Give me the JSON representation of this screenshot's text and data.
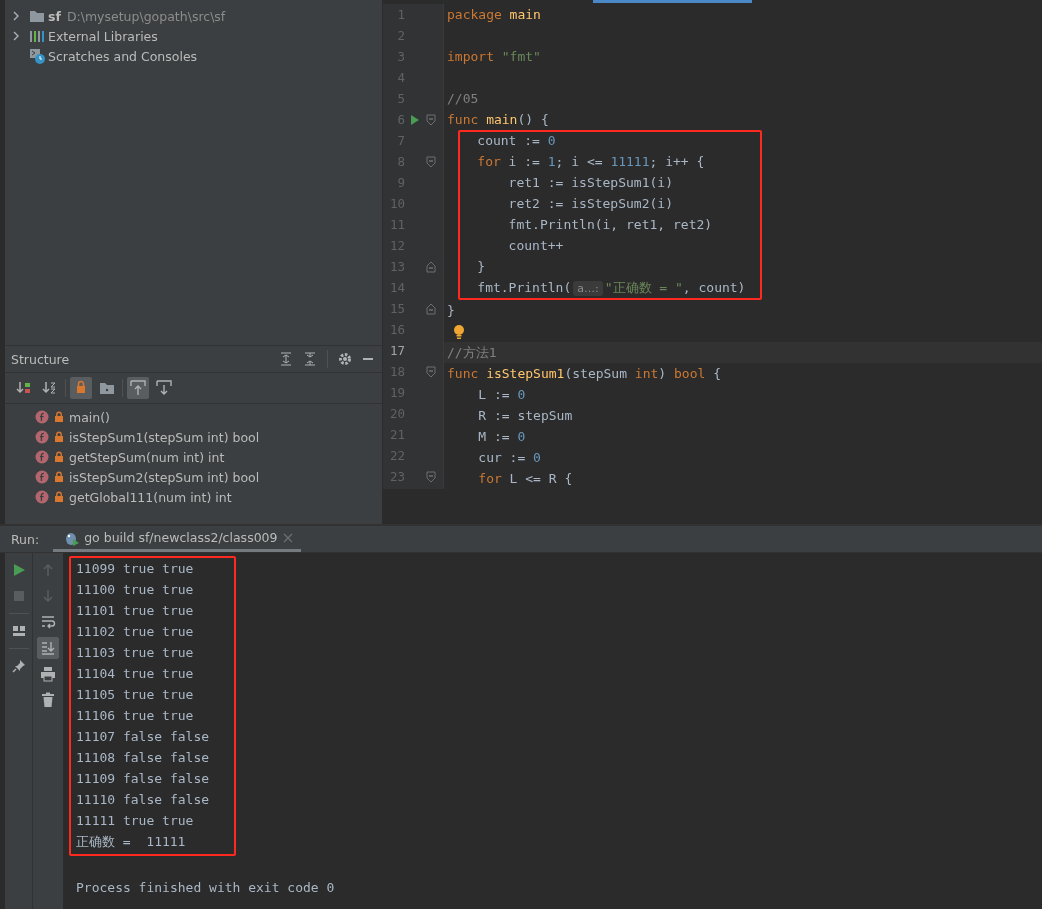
{
  "project_tree": {
    "items": [
      {
        "kind": "folder",
        "name": "sf",
        "path": "D:\\mysetup\\gopath\\src\\sf",
        "expandable": true
      },
      {
        "kind": "libraries",
        "name": "External Libraries",
        "expandable": true
      },
      {
        "kind": "scratches",
        "name": "Scratches and Consoles",
        "expandable": false
      }
    ]
  },
  "structure": {
    "title": "Structure",
    "toolbar": [
      {
        "kind": "sort-visibility",
        "selected": false
      },
      {
        "kind": "sort-alpha",
        "selected": false
      },
      {
        "kind": "lock",
        "selected": true
      },
      {
        "kind": "folder",
        "selected": false
      },
      {
        "kind": "scroll-to",
        "selected": true
      },
      {
        "kind": "scroll-from",
        "selected": false
      }
    ],
    "items": [
      {
        "label": "main()"
      },
      {
        "label": "isStepSum1(stepSum int) bool"
      },
      {
        "label": "getStepSum(num int) int"
      },
      {
        "label": "isStepSum2(stepSum int) bool"
      },
      {
        "label": "getGlobal111(num int) int"
      }
    ]
  },
  "editor": {
    "lines": [
      {
        "number": "1",
        "tokens": [
          {
            "kind": "keyword",
            "text": "package"
          },
          {
            "kind": "function",
            "text": " main"
          }
        ],
        "fold_start": false,
        "fold_end": false,
        "runnable": false,
        "bulb": false,
        "current": false,
        "boxed": false
      },
      {
        "number": "2",
        "fold_start": false,
        "fold_end": false,
        "runnable": false,
        "bulb": false,
        "current": false
      },
      {
        "number": "3",
        "tokens": [
          {
            "kind": "keyword",
            "text": "import"
          },
          {
            "kind": "string",
            "text": " \"fmt\""
          }
        ],
        "fold_start": false,
        "fold_end": false,
        "runnable": false,
        "bulb": false,
        "current": false,
        "boxed": false
      },
      {
        "number": "4",
        "fold_start": false,
        "fold_end": false,
        "runnable": false,
        "bulb": false,
        "current": false
      },
      {
        "number": "5",
        "tokens": [
          {
            "kind": "comment",
            "text": "//05"
          }
        ],
        "fold_start": false,
        "fold_end": false,
        "runnable": false,
        "bulb": false,
        "current": false,
        "boxed": false
      },
      {
        "number": "6",
        "tokens": [
          {
            "kind": "keyword",
            "text": "func"
          },
          {
            "kind": "function",
            "text": " main"
          },
          {
            "kind": "plain",
            "text": "() {"
          }
        ],
        "fold_start": true,
        "fold_end": false,
        "runnable": true,
        "bulb": false,
        "current": false,
        "boxed": false
      },
      {
        "number": "7",
        "tokens": [
          {
            "kind": "plain",
            "text": "    count := "
          },
          {
            "kind": "number",
            "text": "0"
          }
        ],
        "fold_start": false,
        "fold_end": false,
        "runnable": false,
        "bulb": false,
        "current": false,
        "boxed": true
      },
      {
        "number": "8",
        "tokens": [
          {
            "kind": "keyword",
            "text": "    for"
          },
          {
            "kind": "plain",
            "text": " i := "
          },
          {
            "kind": "number",
            "text": "1"
          },
          {
            "kind": "plain",
            "text": "; i <= "
          },
          {
            "kind": "number",
            "text": "11111"
          },
          {
            "kind": "plain",
            "text": "; i++ {"
          }
        ],
        "fold_start": true,
        "fold_end": false,
        "runnable": false,
        "bulb": false,
        "current": false,
        "boxed": true
      },
      {
        "number": "9",
        "tokens": [
          {
            "kind": "plain",
            "text": "        ret1 := isStepSum1(i)"
          }
        ],
        "fold_start": false,
        "fold_end": false,
        "runnable": false,
        "bulb": false,
        "current": false,
        "boxed": true
      },
      {
        "number": "10",
        "tokens": [
          {
            "kind": "plain",
            "text": "        ret2 := isStepSum2(i)"
          }
        ],
        "fold_start": false,
        "fold_end": false,
        "runnable": false,
        "bulb": false,
        "current": false,
        "boxed": true
      },
      {
        "number": "11",
        "tokens": [
          {
            "kind": "plain",
            "text": "        fmt.Println(i, ret1, ret2)"
          }
        ],
        "fold_start": false,
        "fold_end": false,
        "runnable": false,
        "bulb": false,
        "current": false,
        "boxed": true
      },
      {
        "number": "12",
        "tokens": [
          {
            "kind": "plain",
            "text": "        count++"
          }
        ],
        "fold_start": false,
        "fold_end": false,
        "runnable": false,
        "bulb": false,
        "current": false,
        "boxed": true
      },
      {
        "number": "13",
        "tokens": [
          {
            "kind": "plain",
            "text": "    }"
          }
        ],
        "fold_start": false,
        "fold_end": true,
        "runnable": false,
        "bulb": false,
        "current": false,
        "boxed": true
      },
      {
        "number": "14",
        "tokens": [
          {
            "kind": "plain",
            "text": "    fmt.Println("
          },
          {
            "kind": "hint",
            "text": "a…:"
          },
          {
            "kind": "string",
            "text": "\"正确数 = \""
          },
          {
            "kind": "plain",
            "text": ", count)"
          }
        ],
        "fold_start": false,
        "fold_end": false,
        "runnable": false,
        "bulb": false,
        "current": false,
        "boxed": true
      },
      {
        "number": "15",
        "tokens": [
          {
            "kind": "plain",
            "text": "}"
          }
        ],
        "fold_start": false,
        "fold_end": true,
        "runnable": false,
        "bulb": false,
        "current": false,
        "boxed": false
      },
      {
        "number": "16",
        "fold_start": false,
        "fold_end": false,
        "runnable": false,
        "bulb": true,
        "current": false,
        "boxed": false
      },
      {
        "number": "17",
        "tokens": [
          {
            "kind": "comment",
            "text": "//方法1"
          }
        ],
        "fold_start": false,
        "fold_end": false,
        "runnable": false,
        "bulb": false,
        "current": true,
        "boxed": false
      },
      {
        "number": "18",
        "tokens": [
          {
            "kind": "keyword",
            "text": "func"
          },
          {
            "kind": "function",
            "text": " isStepSum1"
          },
          {
            "kind": "plain",
            "text": "(stepSum "
          },
          {
            "kind": "keyword",
            "text": "int"
          },
          {
            "kind": "plain",
            "text": ") "
          },
          {
            "kind": "keyword",
            "text": "bool"
          },
          {
            "kind": "plain",
            "text": " {"
          }
        ],
        "fold_start": true,
        "fold_end": false,
        "runnable": false,
        "bulb": false,
        "current": false,
        "boxed": false
      },
      {
        "number": "19",
        "tokens": [
          {
            "kind": "plain",
            "text": "    L := "
          },
          {
            "kind": "number",
            "text": "0"
          }
        ],
        "fold_start": false,
        "fold_end": false,
        "runnable": false,
        "bulb": false,
        "current": false,
        "boxed": false
      },
      {
        "number": "20",
        "tokens": [
          {
            "kind": "plain",
            "text": "    R := stepSum"
          }
        ],
        "fold_start": false,
        "fold_end": false,
        "runnable": false,
        "bulb": false,
        "current": false,
        "boxed": false
      },
      {
        "number": "21",
        "tokens": [
          {
            "kind": "plain",
            "text": "    M := "
          },
          {
            "kind": "number",
            "text": "0"
          }
        ],
        "fold_start": false,
        "fold_end": false,
        "runnable": false,
        "bulb": false,
        "current": false,
        "boxed": false
      },
      {
        "number": "22",
        "tokens": [
          {
            "kind": "plain",
            "text": "    cur := "
          },
          {
            "kind": "number",
            "text": "0"
          }
        ],
        "fold_start": false,
        "fold_end": false,
        "runnable": false,
        "bulb": false,
        "current": false,
        "boxed": false
      },
      {
        "number": "23",
        "tokens": [
          {
            "kind": "keyword",
            "text": "    for"
          },
          {
            "kind": "plain",
            "text": " L <= R {"
          }
        ],
        "fold_start": true,
        "fold_end": false,
        "runnable": false,
        "bulb": false,
        "current": false,
        "boxed": false
      }
    ]
  },
  "run": {
    "label": "Run:",
    "tab": {
      "title": "go build sf/newclass2/class009",
      "selected": true
    },
    "toolbar_left": [
      {
        "kind": "run",
        "selected": false
      },
      {
        "kind": "stop",
        "selected": false
      },
      {
        "kind": "layout",
        "selected": false
      },
      {
        "kind": "pin",
        "selected": false
      }
    ],
    "toolbar_right": [
      {
        "kind": "up",
        "selected": false
      },
      {
        "kind": "down",
        "selected": false
      },
      {
        "kind": "wrap",
        "selected": false
      },
      {
        "kind": "scroll-end",
        "selected": true
      },
      {
        "kind": "print",
        "selected": false
      },
      {
        "kind": "trash",
        "selected": false
      }
    ],
    "output": [
      {
        "text": "11099 true true",
        "boxed": true
      },
      {
        "text": "11100 true true",
        "boxed": true
      },
      {
        "text": "11101 true true",
        "boxed": true
      },
      {
        "text": "11102 true true",
        "boxed": true
      },
      {
        "text": "11103 true true",
        "boxed": true
      },
      {
        "text": "11104 true true",
        "boxed": true
      },
      {
        "text": "11105 true true",
        "boxed": true
      },
      {
        "text": "11106 true true",
        "boxed": true
      },
      {
        "text": "11107 false false",
        "boxed": true
      },
      {
        "text": "11108 false false",
        "boxed": true
      },
      {
        "text": "11109 false false",
        "boxed": true
      },
      {
        "text": "11110 false false",
        "boxed": true
      },
      {
        "text": "11111 true true",
        "boxed": true
      },
      {
        "text": "正确数 =  11111",
        "boxed": true
      }
    ],
    "exit_message": "Process finished with exit code 0"
  }
}
